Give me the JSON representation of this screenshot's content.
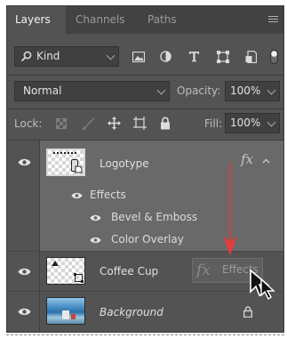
{
  "tabs": [
    {
      "label": "Layers",
      "active": true
    },
    {
      "label": "Channels",
      "active": false
    },
    {
      "label": "Paths",
      "active": false
    }
  ],
  "filter": {
    "kind_label": "Kind",
    "icons": [
      "image-filter-icon",
      "adjustment-filter-icon",
      "type-filter-icon",
      "shape-filter-icon",
      "smart-object-filter-icon",
      "filter-toggle-icon"
    ]
  },
  "blend": {
    "mode": "Normal",
    "opacity_label": "Opacity:",
    "opacity_value": "100%"
  },
  "lock": {
    "label": "Lock:",
    "fill_label": "Fill:",
    "fill_value": "100%",
    "icons": [
      "lock-transparent-pixels-icon",
      "lock-image-pixels-icon",
      "lock-position-icon",
      "lock-artboard-icon",
      "lock-all-icon"
    ]
  },
  "layers": [
    {
      "name": "Logotype",
      "fx": "fx",
      "effects_label": "Effects",
      "effects": [
        "Bevel & Emboss",
        "Color Overlay"
      ]
    },
    {
      "name": "Coffee Cup",
      "fx": "fx",
      "drag_label": "Effects"
    },
    {
      "name": "Background",
      "italic": true,
      "locked": true
    }
  ],
  "colors": {
    "panel": "#535353",
    "tab_bar": "#424242",
    "arrow": "#e83a3f",
    "field": "#404040"
  }
}
